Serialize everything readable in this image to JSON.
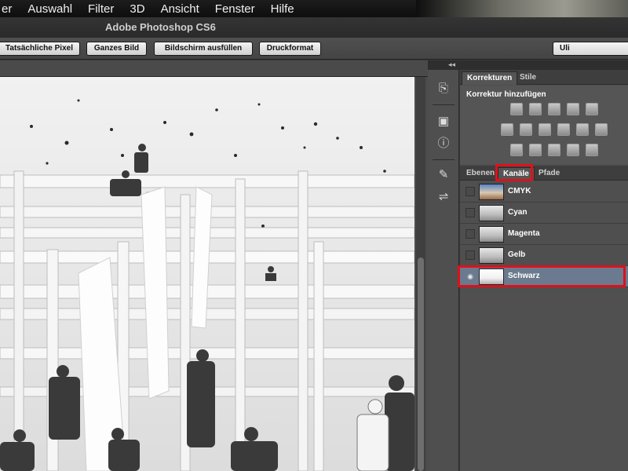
{
  "menubar": {
    "items": [
      "er",
      "Auswahl",
      "Filter",
      "3D",
      "Ansicht",
      "Fenster",
      "Hilfe"
    ]
  },
  "window": {
    "title": "Adobe Photoshop CS6"
  },
  "options_bar": {
    "buttons": [
      "Tatsächliche Pixel",
      "Ganzes Bild",
      "Bildschirm ausfüllen",
      "Druckformat"
    ],
    "workspace": "Uli"
  },
  "panels": {
    "collapse_glyph": "◂◂",
    "korrekturen": {
      "tabs": [
        "Korrekturen",
        "Stile"
      ],
      "heading": "Korrektur hinzufügen"
    },
    "channels": {
      "tabs": [
        "Ebenen",
        "Kanäle",
        "Pfade"
      ],
      "active_tab": "Kanäle",
      "items": [
        {
          "label": "CMYK",
          "visible": false
        },
        {
          "label": "Cyan",
          "visible": false
        },
        {
          "label": "Magenta",
          "visible": false
        },
        {
          "label": "Gelb",
          "visible": false
        },
        {
          "label": "Schwarz",
          "visible": true,
          "selected": true
        }
      ]
    }
  },
  "colors": {
    "highlight": "#e0101a",
    "selected_row": "#6b7a8e"
  }
}
